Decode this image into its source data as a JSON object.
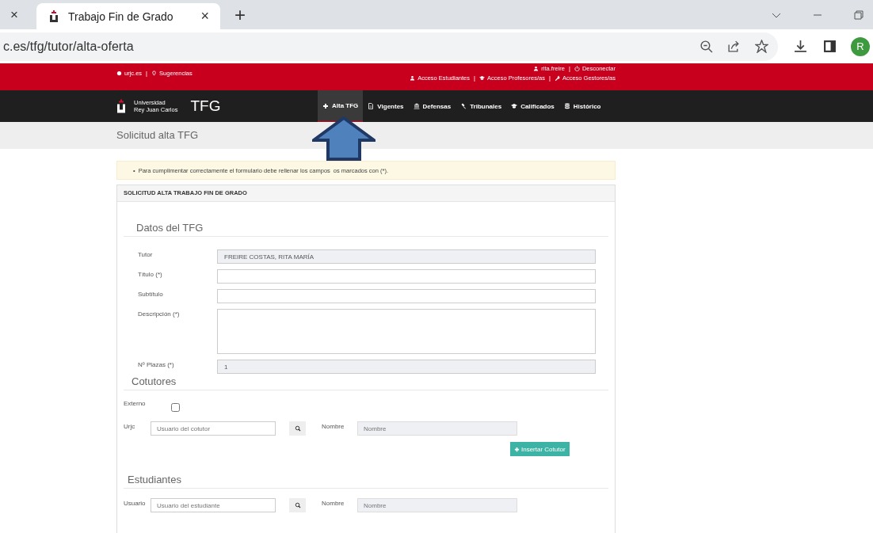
{
  "browser": {
    "prev_tab_close": "×",
    "tab": {
      "title": "Trabajo Fin de Grado",
      "close": "×"
    },
    "new_tab": "+",
    "url": "c.es/tfg/tutor/alta-oferta",
    "profile": "R"
  },
  "topbar": {
    "separator": "|",
    "left": [
      {
        "label": "urjc.es"
      },
      {
        "label": "Sugerencias"
      }
    ],
    "user": [
      {
        "label": "rita.freire"
      },
      {
        "label": "Desconectar"
      }
    ],
    "access": [
      {
        "label": "Acceso Estudiantes"
      },
      {
        "label": "Acceso Profesores/as"
      },
      {
        "label": "Acceso Gestores/as"
      }
    ]
  },
  "brand": {
    "university": [
      "Universidad",
      "Rey Juan Carlos"
    ],
    "app": "TFG"
  },
  "nav": [
    {
      "label": "Alta TFG",
      "selected": true
    },
    {
      "label": "Vigentes",
      "selected": false
    },
    {
      "label": "Defensas",
      "selected": false
    },
    {
      "label": "Tribunales",
      "selected": false
    },
    {
      "label": "Calificados",
      "selected": false
    },
    {
      "label": "Histórico",
      "selected": false
    }
  ],
  "page_title": "Solicitud alta TFG",
  "notice_bullet": "•",
  "notice": [
    "Para cumplimentar correctamente el formulario debe rellenar los campos",
    "os marcados con (*)."
  ],
  "panel_title": "SOLICITUD ALTA TRABAJO FIN DE GRADO",
  "datos": {
    "heading": "Datos del TFG",
    "fields": [
      {
        "label": "Tutor",
        "kind": "readonly",
        "value": "FREIRE COSTAS, RITA MARÍA"
      },
      {
        "label": "Título (*)",
        "kind": "input"
      },
      {
        "label": "Subtítulo",
        "kind": "input"
      },
      {
        "label": "Descripción (*)",
        "kind": "textarea"
      },
      {
        "label": "Nº Plazas (*)",
        "kind": "readonly",
        "value": "1"
      }
    ]
  },
  "cotutores": {
    "heading": "Cotutores",
    "externo": {
      "label": "Externo",
      "checked": false
    },
    "user_label": "Urjc",
    "user_placeholder": "Usuario del cotutor",
    "name_label": "Nombre",
    "name_placeholder": "Nombre",
    "button": "Insertar Cotutor"
  },
  "estudiantes": {
    "heading": "Estudiantes",
    "user_label": "Usuario",
    "user_placeholder": "Usuario del estudiante",
    "name_label": "Nombre",
    "name_placeholder": "Nombre"
  }
}
